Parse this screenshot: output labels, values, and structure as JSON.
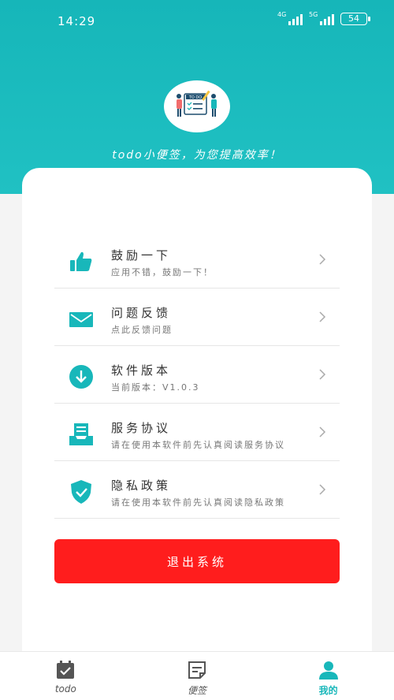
{
  "status_bar": {
    "time": "14:29",
    "net1": "4G",
    "net2": "5G",
    "battery": "54"
  },
  "header": {
    "slogan": "todo小便签，为您提高效率！"
  },
  "menu": [
    {
      "title": "鼓励一下",
      "subtitle": "应用不错，鼓励一下！",
      "icon": "thumbs-up-icon"
    },
    {
      "title": "问题反馈",
      "subtitle": "点此反馈问题",
      "icon": "mail-icon"
    },
    {
      "title": "软件版本",
      "subtitle": "当前版本：V1.0.3",
      "icon": "download-icon"
    },
    {
      "title": "服务协议",
      "subtitle": "请在使用本软件前先认真阅读服务协议",
      "icon": "document-tray-icon"
    },
    {
      "title": "隐私政策",
      "subtitle": "请在使用本软件前先认真阅读隐私政策",
      "icon": "shield-check-icon"
    }
  ],
  "logout_label": "退出系统",
  "tabs": [
    {
      "label": "todo",
      "icon": "calendar-check-icon",
      "active": false
    },
    {
      "label": "便签",
      "icon": "note-icon",
      "active": false
    },
    {
      "label": "我的",
      "icon": "user-icon",
      "active": true
    }
  ],
  "colors": {
    "accent": "#18b7ba",
    "logout": "#ff1d1d"
  }
}
